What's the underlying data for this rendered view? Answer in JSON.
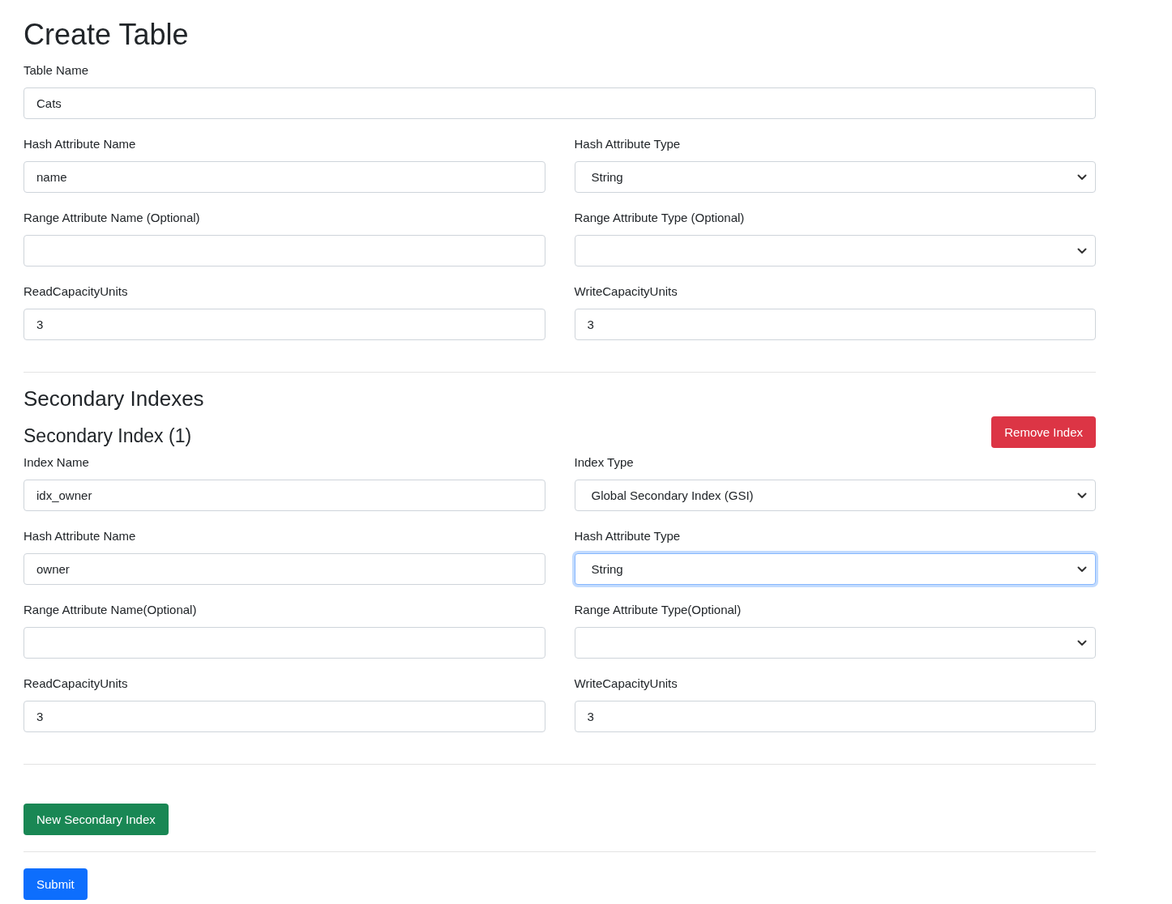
{
  "title": "Create Table",
  "table_name": {
    "label": "Table Name",
    "value": "Cats"
  },
  "fields": [
    {
      "label": "Hash Attribute Name",
      "kind": "input",
      "value": "name",
      "focused": false
    },
    {
      "label": "Hash Attribute Type",
      "kind": "select",
      "value": "String",
      "focused": false
    },
    {
      "label": "Range Attribute Name (Optional)",
      "kind": "input",
      "focused": false
    },
    {
      "label": "Range Attribute Type (Optional)",
      "kind": "select",
      "focused": false
    },
    {
      "label": "ReadCapacityUnits",
      "kind": "input",
      "value": "3",
      "focused": false
    },
    {
      "label": "WriteCapacityUnits",
      "kind": "input",
      "value": "3",
      "focused": false
    }
  ],
  "secondary": {
    "heading": "Secondary Indexes",
    "indexes": [
      {
        "title": "Secondary Index (1)",
        "remove_button": "Remove Index",
        "fields": [
          {
            "label": "Index Name",
            "kind": "input",
            "value": "idx_owner",
            "focused": false
          },
          {
            "label": "Index Type",
            "kind": "select",
            "value": "Global Secondary Index (GSI)",
            "focused": false
          },
          {
            "label": "Hash Attribute Name",
            "kind": "input",
            "value": "owner",
            "focused": false
          },
          {
            "label": "Hash Attribute Type",
            "kind": "select",
            "value": "String",
            "focused": true
          },
          {
            "label": "Range Attribute Name(Optional)",
            "kind": "input",
            "focused": false
          },
          {
            "label": "Range Attribute Type(Optional)",
            "kind": "select",
            "focused": false
          },
          {
            "label": "ReadCapacityUnits",
            "kind": "input",
            "value": "3",
            "focused": false
          },
          {
            "label": "WriteCapacityUnits",
            "kind": "input",
            "value": "3",
            "focused": false
          }
        ]
      }
    ]
  },
  "new_index_button": "New Secondary Index",
  "submit_button": "Submit"
}
